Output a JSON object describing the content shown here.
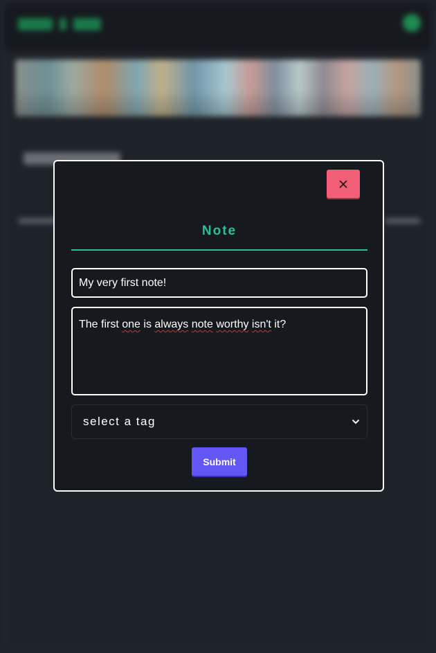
{
  "modal": {
    "close_icon": "close-x-icon",
    "title": "Note",
    "title_input_value": "My very first note!",
    "body_text_parts": [
      "The first ",
      "one",
      " is ",
      "always",
      " ",
      "note",
      " ",
      "worthy",
      " ",
      "isn't",
      " it?"
    ],
    "tag_select": {
      "selected": "select a tag",
      "chevron_icon": "chevron-down-icon"
    },
    "submit_label": "Submit"
  },
  "colors": {
    "accent": "#28c09a",
    "close_button": "#f25e76",
    "submit_button": "#6257f5",
    "modal_bg": "#16191e",
    "page_bg": "#1f232b"
  }
}
